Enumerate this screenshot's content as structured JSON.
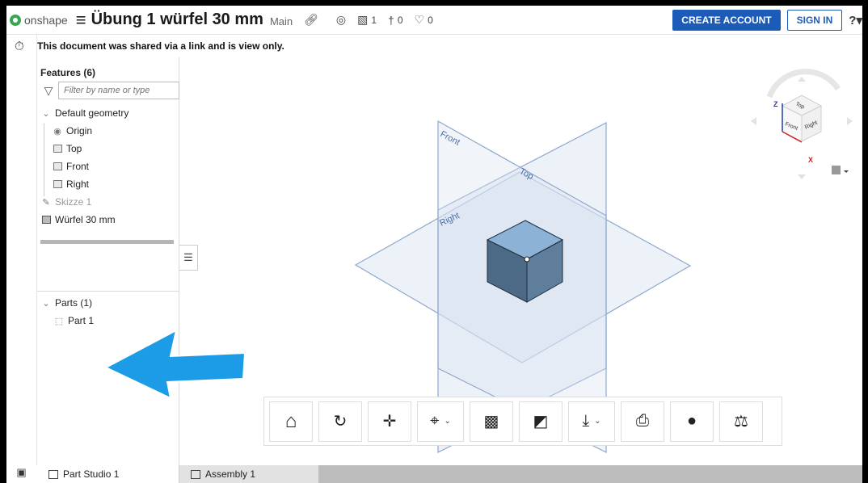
{
  "header": {
    "brand": "onshape",
    "title": "Übung 1 würfel 30 mm",
    "branch": "Main",
    "versions_count": "1",
    "branches_count": "0",
    "likes_count": "0",
    "create_account": "CREATE ACCOUNT",
    "sign_in": "SIGN IN"
  },
  "notice": "This document was shared via a link and is view only.",
  "features": {
    "title": "Features (6)",
    "filter_placeholder": "Filter by name or type",
    "default_geometry": "Default geometry",
    "origin": "Origin",
    "top": "Top",
    "front": "Front",
    "right": "Right",
    "sketch": "Skizze 1",
    "extrude": "Würfel 30 mm"
  },
  "parts": {
    "title": "Parts (1)",
    "part1": "Part 1"
  },
  "viewport": {
    "plane_front": "Front",
    "plane_top": "Top",
    "plane_right": "Right",
    "cube_top": "Top",
    "cube_front": "Front",
    "cube_right": "Right",
    "axis_z": "Z",
    "axis_x": "X"
  },
  "tabs": {
    "tab1": "Part Studio 1",
    "tab2": "Assembly 1"
  },
  "colors": {
    "brand_blue": "#1d5bb8",
    "plane_fill": "#dfe7f3",
    "cube_top": "#8cb3d6",
    "cube_left": "#4c6a86",
    "cube_right": "#5e7e9c",
    "arrow": "#1c9be6"
  },
  "icons": [
    "onshape-logo-icon",
    "menu-icon",
    "link-icon",
    "globe-icon",
    "versions-icon",
    "branch-icon",
    "like-icon",
    "help-icon",
    "stopwatch-icon",
    "filter-icon",
    "home-icon",
    "rotate-icon",
    "pan-icon",
    "zoom-icon",
    "section-icon",
    "appearance-icon",
    "download-icon",
    "print-icon",
    "measure-icon",
    "mass-properties-icon"
  ]
}
